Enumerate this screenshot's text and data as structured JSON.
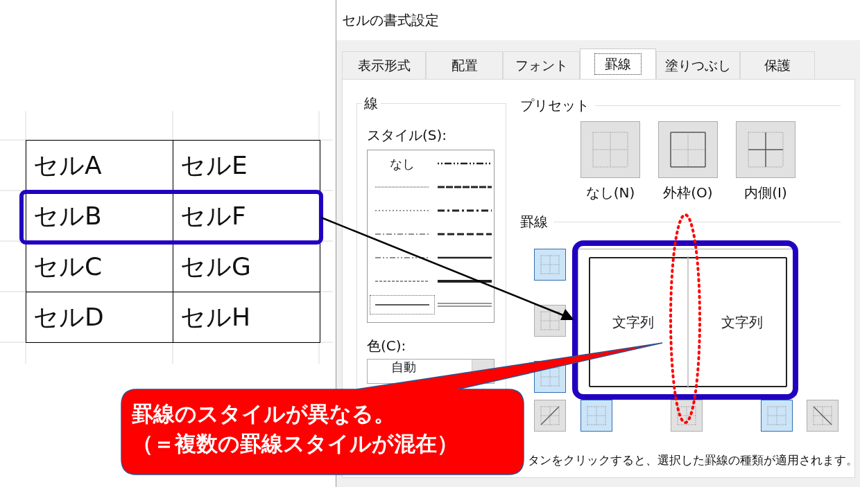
{
  "sheet": {
    "rows": [
      {
        "cells": [
          "セルA",
          "セルE"
        ]
      },
      {
        "cells": [
          "セルB",
          "セルF"
        ]
      },
      {
        "cells": [
          "セルC",
          "セルG"
        ]
      },
      {
        "cells": [
          "セルD",
          "セルH"
        ]
      }
    ]
  },
  "dialog": {
    "title": "セルの書式設定",
    "tabs": [
      {
        "label": "表示形式",
        "selected": false
      },
      {
        "label": "配置",
        "selected": false
      },
      {
        "label": "フォント",
        "selected": false
      },
      {
        "label": "罫線",
        "selected": true
      },
      {
        "label": "塗りつぶし",
        "selected": false
      },
      {
        "label": "保護",
        "selected": false
      }
    ],
    "line_group": {
      "title": "線",
      "style_label": "スタイル(S):",
      "styles": [
        {
          "kind": "none",
          "label": "なし",
          "selected": false
        },
        {
          "kind": "hair",
          "selected": false
        },
        {
          "kind": "dotted",
          "selected": false
        },
        {
          "kind": "dashdot",
          "selected": false
        },
        {
          "kind": "dashdotdot",
          "selected": false
        },
        {
          "kind": "dashed",
          "selected": false
        },
        {
          "kind": "thin",
          "selected": true
        },
        {
          "kind": "medium-dashdotdot",
          "selected": false
        },
        {
          "kind": "slanted",
          "selected": false
        },
        {
          "kind": "medium-dashdot",
          "selected": false
        },
        {
          "kind": "medium-dashed",
          "selected": false
        },
        {
          "kind": "medium",
          "selected": false
        },
        {
          "kind": "thick",
          "selected": false
        },
        {
          "kind": "double",
          "selected": false
        }
      ],
      "color_label": "色(C):",
      "color_value": "自動"
    },
    "presets": {
      "title": "プリセット",
      "buttons": [
        {
          "kind": "none",
          "label": "なし(N)"
        },
        {
          "kind": "outline",
          "label": "外枠(O)"
        },
        {
          "kind": "inside",
          "label": "内側(I)"
        }
      ]
    },
    "border": {
      "title": "罫線",
      "side_buttons": [
        {
          "kind": "top",
          "selected": true
        },
        {
          "kind": "inner-horizontal",
          "selected": false
        },
        {
          "kind": "bottom",
          "selected": true
        }
      ],
      "bottom_buttons": [
        {
          "kind": "diagonal-up",
          "selected": false
        },
        {
          "kind": "left",
          "selected": true
        },
        {
          "kind": "inner-vertical",
          "selected": false
        },
        {
          "kind": "right",
          "selected": true
        },
        {
          "kind": "diagonal-down",
          "selected": false
        }
      ],
      "preview_texts": [
        "文字列",
        "文字列"
      ],
      "hint": "タンをクリックすると、選択した罫線の種類が適用されます。"
    }
  },
  "callout": {
    "lines": [
      "罫線のスタイルが異なる。",
      "（＝複数の罫線スタイルが混在）"
    ]
  }
}
